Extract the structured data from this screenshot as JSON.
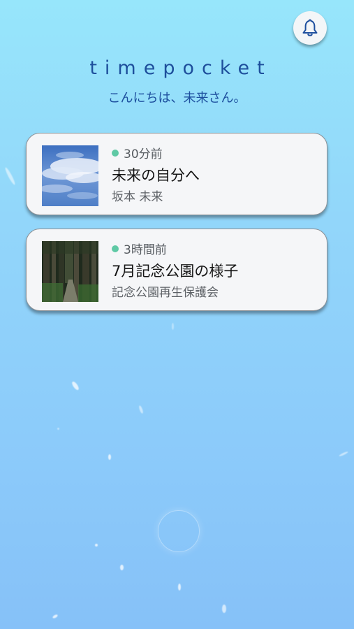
{
  "app": {
    "logo": "timepocket",
    "greeting": "こんにちは、未来さん。"
  },
  "header": {
    "notification_icon": "bell-icon"
  },
  "messages": [
    {
      "time": "30分前",
      "title": "未来の自分へ",
      "sender": "坂本 未来",
      "thumbnail": "sky-clouds-photo",
      "status_color": "#5fc9a5"
    },
    {
      "time": "3時間前",
      "title": "7月記念公園の様子",
      "sender": "記念公園再生保護会",
      "thumbnail": "forest-path-photo",
      "status_color": "#5fc9a5"
    }
  ],
  "colors": {
    "background_top": "#97e6fb",
    "background_bottom": "#86c1f8",
    "brand": "#1e4f9c",
    "card": "#f5f6f8"
  }
}
